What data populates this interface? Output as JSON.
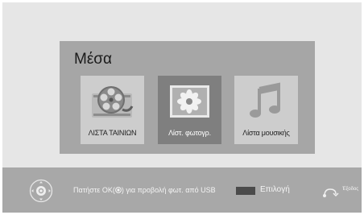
{
  "panel": {
    "title": "Μέσα",
    "items": [
      {
        "label": "ΛΙΣΤΑ ΤΑΙΝΙΩΝ",
        "icon": "film-reel-icon",
        "selected": false
      },
      {
        "label": "Λίστ. φωτογρ.",
        "icon": "photo-icon",
        "selected": true
      },
      {
        "label": "Λίστα μουσικής",
        "icon": "music-note-icon",
        "selected": false
      }
    ]
  },
  "footer": {
    "hint_before": "Πατήστε ΟΚ(",
    "hint_after": ") για προβολή φωτ. από  USB",
    "select_label": "Επιλογή",
    "exit_label": "Έξοδος",
    "select_key_color": "#4b4b4b"
  }
}
